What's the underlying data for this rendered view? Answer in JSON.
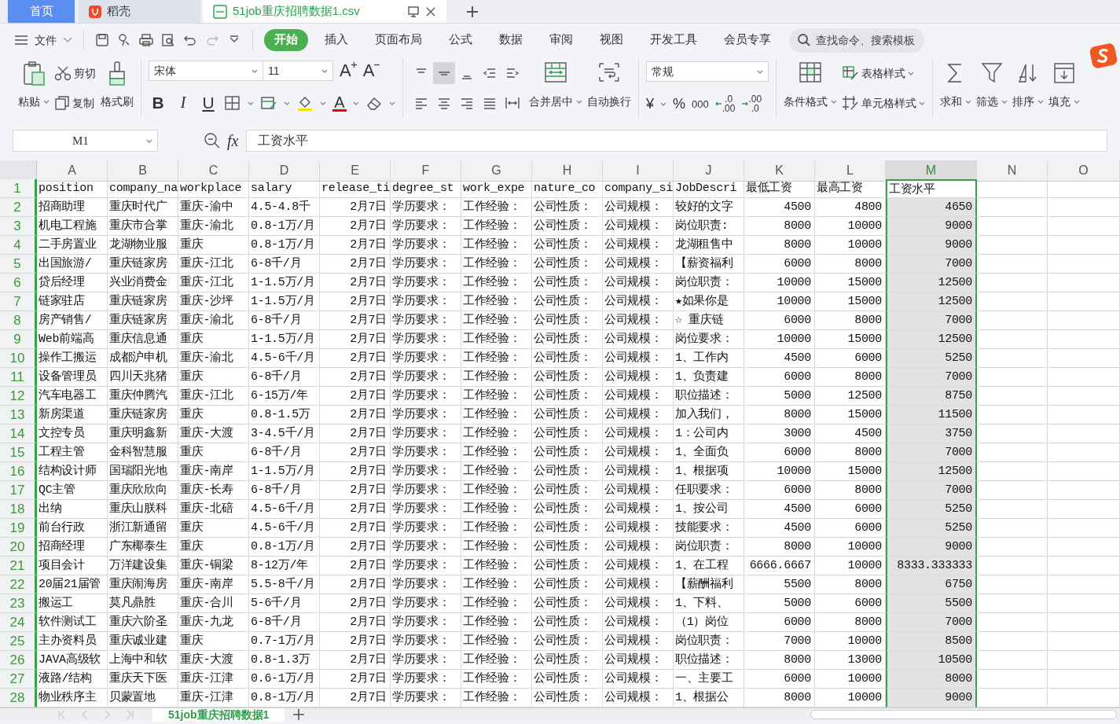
{
  "tabs": [
    {
      "label": "首页",
      "kind": "home",
      "selected": false
    },
    {
      "label": "稻壳",
      "kind": "docer",
      "selected": false
    },
    {
      "label": "51job重庆招聘数据1.csv",
      "kind": "file",
      "selected": true
    }
  ],
  "menu": {
    "file": "文件",
    "tabs": [
      {
        "label": "开始",
        "selected": true
      },
      {
        "label": "插入",
        "selected": false
      },
      {
        "label": "页面布局",
        "selected": false
      },
      {
        "label": "公式",
        "selected": false
      },
      {
        "label": "数据",
        "selected": false
      },
      {
        "label": "审阅",
        "selected": false
      },
      {
        "label": "视图",
        "selected": false
      },
      {
        "label": "开发工具",
        "selected": false
      },
      {
        "label": "会员专享",
        "selected": false
      }
    ],
    "search": {
      "placeholder": "查找命令、搜索模板"
    }
  },
  "ribbon": {
    "paste": "粘贴",
    "cut": "剪切",
    "copy": "复制",
    "format_painter": "格式刷",
    "font_name": "宋体",
    "font_size": "11",
    "font_buttons": [
      {
        "kind": "grow",
        "label": "A"
      },
      {
        "kind": "shrink",
        "label": "A"
      }
    ],
    "style_buttons": [
      {
        "kind": "bold",
        "label": "B"
      },
      {
        "kind": "italic",
        "label": "I"
      },
      {
        "kind": "underline",
        "label": "U"
      }
    ],
    "font_color": "A",
    "align_buttons": [
      {
        "selected": false
      },
      {
        "selected": true
      },
      {
        "selected": false
      },
      {
        "selected": false
      },
      {
        "selected": false
      },
      {
        "selected": false
      },
      {
        "selected": false
      },
      {
        "selected": false
      },
      {
        "selected": false
      },
      {
        "selected": false
      }
    ],
    "merge": "合并居中",
    "wrap": "自动换行",
    "number_format": "常规",
    "number_buttons": [
      {
        "kind": "symbol",
        "label": "¥"
      },
      {
        "kind": "symbol",
        "label": "%"
      },
      {
        "kind": "thousands",
        "label": "000"
      },
      {
        "kind": "decimal_more",
        "top": ".0",
        "bottom": ".00"
      },
      {
        "kind": "decimal_less",
        "top": ".00",
        "bottom": ".0"
      }
    ],
    "conditional_format": "条件格式",
    "table_style": "表格样式",
    "cell_style": "单元格样式",
    "editing": [
      "求和",
      "筛选",
      "排序",
      "填充"
    ]
  },
  "formula_bar": {
    "name_box": "M1",
    "fx": "fx",
    "formula": "工资水平"
  },
  "sheet": {
    "columns": [
      {
        "label": "A",
        "kind": "text",
        "selected": false
      },
      {
        "label": "B",
        "kind": "text",
        "selected": false
      },
      {
        "label": "C",
        "kind": "text",
        "selected": false
      },
      {
        "label": "D",
        "kind": "text",
        "selected": false
      },
      {
        "label": "E",
        "kind": "number",
        "selected": false
      },
      {
        "label": "F",
        "kind": "text",
        "selected": false
      },
      {
        "label": "G",
        "kind": "text",
        "selected": false
      },
      {
        "label": "H",
        "kind": "text",
        "selected": false
      },
      {
        "label": "I",
        "kind": "text",
        "selected": false
      },
      {
        "label": "J",
        "kind": "text",
        "selected": false
      },
      {
        "label": "K",
        "kind": "number",
        "selected": false
      },
      {
        "label": "L",
        "kind": "number",
        "selected": false
      },
      {
        "label": "M",
        "kind": "number",
        "selected": true
      },
      {
        "label": "N",
        "kind": "text",
        "selected": false
      },
      {
        "label": "O",
        "kind": "text",
        "selected": false
      }
    ],
    "rows": [
      {
        "number": "1",
        "kind": "header",
        "active": true,
        "cells": [
          "position",
          "company_na",
          "workplace",
          "salary",
          "release_ti",
          "degree_st",
          "work_expe",
          "nature_co",
          "company_si",
          "JobDescri",
          "最低工资",
          "最高工资",
          "工资水平"
        ]
      },
      {
        "number": "2",
        "kind": "data",
        "active": false,
        "cells": [
          "招商助理",
          "重庆时代广",
          "重庆-渝中",
          "4.5-4.8千",
          "2月7日",
          "学历要求：",
          "工作经验：",
          "公司性质：",
          "公司规模：",
          "较好的文字",
          "4500",
          "4800",
          "4650"
        ]
      },
      {
        "number": "3",
        "kind": "data",
        "active": false,
        "cells": [
          "机电工程施",
          "重庆市合掌",
          "重庆-渝北",
          "0.8-1万/月",
          "2月7日",
          "学历要求：",
          "工作经验：",
          "公司性质：",
          "公司规模：",
          "岗位职责:",
          "8000",
          "10000",
          "9000"
        ]
      },
      {
        "number": "4",
        "kind": "data",
        "active": false,
        "cells": [
          "二手房置业",
          "龙湖物业服",
          "重庆",
          "0.8-1万/月",
          "2月7日",
          "学历要求：",
          "工作经验：",
          "公司性质：",
          "公司规模：",
          "龙湖租售中",
          "8000",
          "10000",
          "9000"
        ]
      },
      {
        "number": "5",
        "kind": "data",
        "active": false,
        "cells": [
          "出国旅游/",
          "重庆链家房",
          "重庆-江北",
          "6-8千/月",
          "2月7日",
          "学历要求：",
          "工作经验：",
          "公司性质：",
          "公司规模：",
          "【薪资福利",
          "6000",
          "8000",
          "7000"
        ]
      },
      {
        "number": "6",
        "kind": "data",
        "active": false,
        "cells": [
          "贷后经理",
          "兴业消费金",
          "重庆-江北",
          "1-1.5万/月",
          "2月7日",
          "学历要求：",
          "工作经验：",
          "公司性质：",
          "公司规模：",
          "岗位职责：",
          "10000",
          "15000",
          "12500"
        ]
      },
      {
        "number": "7",
        "kind": "data",
        "active": false,
        "cells": [
          "链家驻店",
          "重庆链家房",
          "重庆-沙坪",
          "1-1.5万/月",
          "2月7日",
          "学历要求：",
          "工作经验：",
          "公司性质：",
          "公司规模：",
          "★如果你是",
          "10000",
          "15000",
          "12500"
        ]
      },
      {
        "number": "8",
        "kind": "data",
        "active": false,
        "cells": [
          "房产销售/",
          "重庆链家房",
          "重庆-渝北",
          "6-8千/月",
          "2月7日",
          "学历要求：",
          "工作经验：",
          "公司性质：",
          "公司规模：",
          "☆ 重庆链",
          "6000",
          "8000",
          "7000"
        ]
      },
      {
        "number": "9",
        "kind": "data",
        "active": false,
        "cells": [
          "Web前端高",
          "重庆信息通",
          "重庆",
          "1-1.5万/月",
          "2月7日",
          "学历要求：",
          "工作经验：",
          "公司性质：",
          "公司规模：",
          "岗位要求：",
          "10000",
          "15000",
          "12500"
        ]
      },
      {
        "number": "10",
        "kind": "data",
        "active": false,
        "cells": [
          "操作工搬运",
          "成都沪申机",
          "重庆-渝北",
          "4.5-6千/月",
          "2月7日",
          "学历要求：",
          "工作经验：",
          "公司性质：",
          "公司规模：",
          "1、工作内",
          "4500",
          "6000",
          "5250"
        ]
      },
      {
        "number": "11",
        "kind": "data",
        "active": false,
        "cells": [
          "设备管理员",
          "四川天兆猪",
          "重庆",
          "6-8千/月",
          "2月7日",
          "学历要求：",
          "工作经验：",
          "公司性质：",
          "公司规模：",
          "1、负责建",
          "6000",
          "8000",
          "7000"
        ]
      },
      {
        "number": "12",
        "kind": "data",
        "active": false,
        "cells": [
          "汽车电器工",
          "重庆仲腾汽",
          "重庆-江北",
          "6-15万/年",
          "2月7日",
          "学历要求：",
          "工作经验：",
          "公司性质：",
          "公司规模：",
          "职位描述：",
          "5000",
          "12500",
          "8750"
        ]
      },
      {
        "number": "13",
        "kind": "data",
        "active": false,
        "cells": [
          "新房渠道",
          "重庆链家房",
          "重庆",
          "0.8-1.5万",
          "2月7日",
          "学历要求：",
          "工作经验：",
          "公司性质：",
          "公司规模：",
          "加入我们，",
          "8000",
          "15000",
          "11500"
        ]
      },
      {
        "number": "14",
        "kind": "data",
        "active": false,
        "cells": [
          "文控专员",
          "重庆明鑫新",
          "重庆-大渡",
          "3-4.5千/月",
          "2月7日",
          "学历要求：",
          "工作经验：",
          "公司性质：",
          "公司规模：",
          "1：公司内",
          "3000",
          "4500",
          "3750"
        ]
      },
      {
        "number": "15",
        "kind": "data",
        "active": false,
        "cells": [
          "工程主管",
          "金科智慧服",
          "重庆",
          "6-8千/月",
          "2月7日",
          "学历要求：",
          "工作经验：",
          "公司性质：",
          "公司规模：",
          "1、全面负",
          "6000",
          "8000",
          "7000"
        ]
      },
      {
        "number": "16",
        "kind": "data",
        "active": false,
        "cells": [
          "结构设计师",
          "国瑞阳光地",
          "重庆-南岸",
          "1-1.5万/月",
          "2月7日",
          "学历要求：",
          "工作经验：",
          "公司性质：",
          "公司规模：",
          "1、根据项",
          "10000",
          "15000",
          "12500"
        ]
      },
      {
        "number": "17",
        "kind": "data",
        "active": false,
        "cells": [
          "QC主管",
          "重庆欣欣向",
          "重庆-长寿",
          "6-8千/月",
          "2月7日",
          "学历要求：",
          "工作经验：",
          "公司性质：",
          "公司规模：",
          "任职要求：",
          "6000",
          "8000",
          "7000"
        ]
      },
      {
        "number": "18",
        "kind": "data",
        "active": false,
        "cells": [
          "出纳",
          "重庆山朕科",
          "重庆-北碚",
          "4.5-6千/月",
          "2月7日",
          "学历要求：",
          "工作经验：",
          "公司性质：",
          "公司规模：",
          "1、按公司",
          "4500",
          "6000",
          "5250"
        ]
      },
      {
        "number": "19",
        "kind": "data",
        "active": false,
        "cells": [
          "前台行政",
          "浙江新通留",
          "重庆",
          "4.5-6千/月",
          "2月7日",
          "学历要求：",
          "工作经验：",
          "公司性质：",
          "公司规模：",
          "技能要求：",
          "4500",
          "6000",
          "5250"
        ]
      },
      {
        "number": "20",
        "kind": "data",
        "active": false,
        "cells": [
          "招商经理",
          "广东椰泰生",
          "重庆",
          "0.8-1万/月",
          "2月7日",
          "学历要求：",
          "工作经验：",
          "公司性质：",
          "公司规模：",
          "岗位职责：",
          "8000",
          "10000",
          "9000"
        ]
      },
      {
        "number": "21",
        "kind": "data",
        "active": false,
        "cells": [
          "项目会计",
          "万洋建设集",
          "重庆-铜梁",
          "8-12万/年",
          "2月7日",
          "学历要求：",
          "工作经验：",
          "公司性质：",
          "公司规模：",
          "1、在工程",
          "6666.6667",
          "10000",
          "8333.333333"
        ]
      },
      {
        "number": "22",
        "kind": "data",
        "active": false,
        "cells": [
          "20届21届管",
          "重庆闹海房",
          "重庆-南岸",
          "5.5-8千/月",
          "2月7日",
          "学历要求：",
          "工作经验：",
          "公司性质：",
          "公司规模：",
          "【薪酬福利",
          "5500",
          "8000",
          "6750"
        ]
      },
      {
        "number": "23",
        "kind": "data",
        "active": false,
        "cells": [
          "搬运工",
          "莫凡鼎胜",
          "重庆-合川",
          "5-6千/月",
          "2月7日",
          "学历要求：",
          "工作经验：",
          "公司性质：",
          "公司规模：",
          "1、下料、",
          "5000",
          "6000",
          "5500"
        ]
      },
      {
        "number": "24",
        "kind": "data",
        "active": false,
        "cells": [
          "软件测试工",
          "重庆六阶圣",
          "重庆-九龙",
          "6-8千/月",
          "2月7日",
          "学历要求：",
          "工作经验：",
          "公司性质：",
          "公司规模：",
          "（1）岗位",
          "6000",
          "8000",
          "7000"
        ]
      },
      {
        "number": "25",
        "kind": "data",
        "active": false,
        "cells": [
          "主办资料员",
          "重庆诚业建",
          "重庆",
          "0.7-1万/月",
          "2月7日",
          "学历要求：",
          "工作经验：",
          "公司性质：",
          "公司规模：",
          "岗位职责：",
          "7000",
          "10000",
          "8500"
        ]
      },
      {
        "number": "26",
        "kind": "data",
        "active": false,
        "cells": [
          "JAVA高级软",
          "上海中和软",
          "重庆-大渡",
          "0.8-1.3万",
          "2月7日",
          "学历要求：",
          "工作经验：",
          "公司性质：",
          "公司规模：",
          "职位描述：",
          "8000",
          "13000",
          "10500"
        ]
      },
      {
        "number": "27",
        "kind": "data",
        "active": false,
        "cells": [
          "液路/结构",
          "重庆天下医",
          "重庆-江津",
          "0.6-1万/月",
          "2月7日",
          "学历要求：",
          "工作经验：",
          "公司性质：",
          "公司规模：",
          "一、主要工",
          "6000",
          "10000",
          "8000"
        ]
      },
      {
        "number": "28",
        "kind": "data",
        "active": false,
        "cells": [
          "物业秩序主",
          "贝蒙置地",
          "重庆-江津",
          "0.8-1万/月",
          "2月7日",
          "学历要求：",
          "工作经验：",
          "公司性质：",
          "公司规模：",
          "1、根据公",
          "8000",
          "10000",
          "9000"
        ]
      }
    ]
  },
  "sheet_tabs": [
    {
      "label": "51job重庆招聘数据1",
      "selected": true
    }
  ]
}
